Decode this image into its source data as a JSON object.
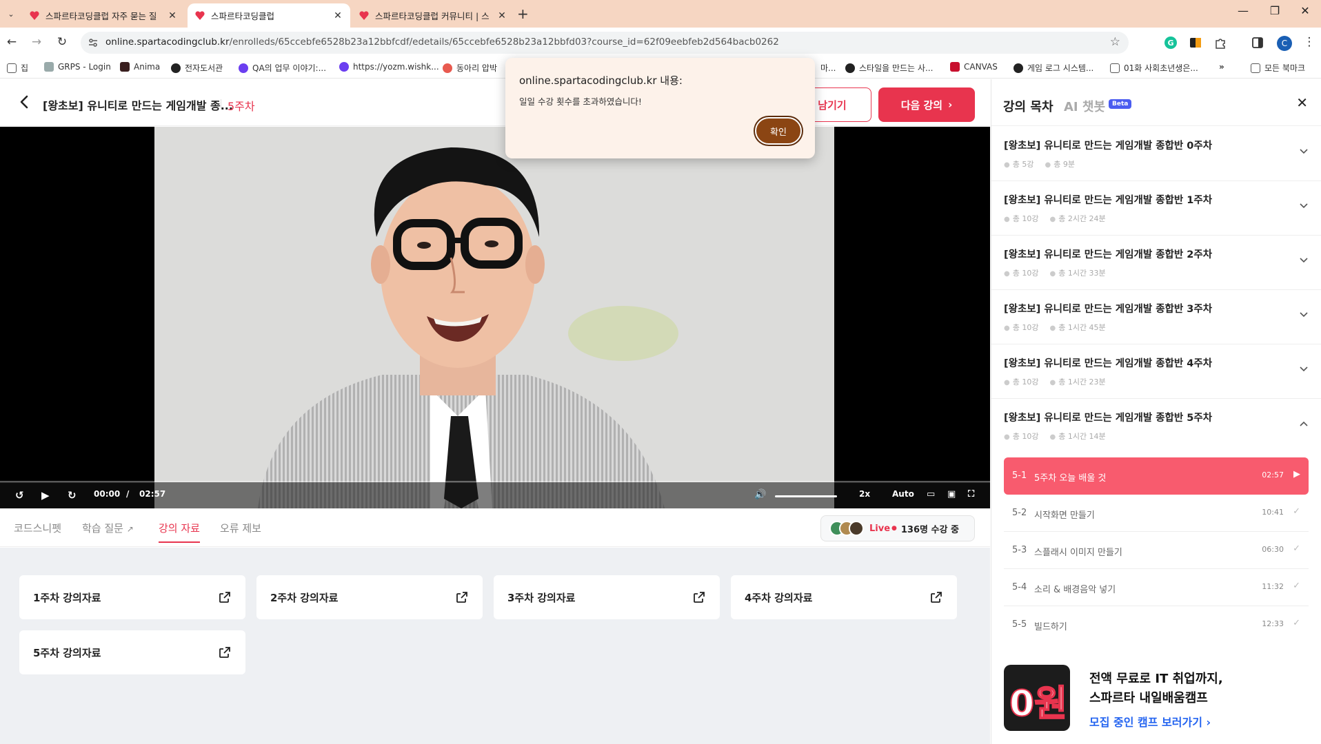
{
  "browser": {
    "tabs": [
      {
        "title": "스파르타코딩클럽 자주 묻는 질"
      },
      {
        "title": "스파르타코딩클럽"
      },
      {
        "title": "스파르타코딩클럽 커뮤니티 | 스"
      }
    ],
    "url_host": "online.spartacodingclub.kr",
    "url_path": "/enrolleds/65ccebfe6528b23a12bbfcdf/edetails/65ccebfe6528b23a12bbfd03?course_id=62f09eebfeb2d564bacb0262",
    "profile_initial": "C",
    "bookmarks": [
      "집",
      "GRPS - Login",
      "Anima",
      "전자도서관",
      "QA의 업무 이야기:...",
      "https://yozm.wishk...",
      "동아리 압박",
      "마...",
      "스타일을 만드는 사...",
      "CANVAS",
      "게임 로그 시스템...",
      "01화 사회초년생은...",
      "모든 북마크"
    ]
  },
  "dialog": {
    "title": "online.spartacodingclub.kr 내용:",
    "message": "일일 수강 횟수를 초과하였습니다!",
    "ok_label": "확인"
  },
  "header": {
    "course_title": "[왕초보] 유니티로 만드는 게임개발 종...",
    "week": "5주차",
    "review_button": "리뷰 남기기",
    "review_button_visible": "남기기",
    "next_button": "다음 강의"
  },
  "player": {
    "current_time": "00:00",
    "divider": "/",
    "duration": "02:57",
    "speed": "2x",
    "quality": "Auto",
    "progress": 0
  },
  "subtabs": {
    "items": [
      {
        "label": "코드스니펫"
      },
      {
        "label": "학습 질문"
      },
      {
        "label": "강의 자료"
      },
      {
        "label": "오류 제보"
      }
    ],
    "live_label": "Live",
    "live_count": "136명 수강 중"
  },
  "materials": [
    {
      "label": "1주차 강의자료"
    },
    {
      "label": "2주차 강의자료"
    },
    {
      "label": "3주차 강의자료"
    },
    {
      "label": "4주차 강의자료"
    },
    {
      "label": "5주차 강의자료"
    }
  ],
  "sidebar": {
    "tab_toc": "강의 목차",
    "tab_ai": "AI 챗봇",
    "beta": "Beta",
    "weeks": [
      {
        "title": "[왕초보] 유니티로 만드는 게임개발 종합반 0주차",
        "count": "총 5강",
        "time": "총 9분"
      },
      {
        "title": "[왕초보] 유니티로 만드는 게임개발 종합반 1주차",
        "count": "총 10강",
        "time": "총 2시간 24분"
      },
      {
        "title": "[왕초보] 유니티로 만드는 게임개발 종합반 2주차",
        "count": "총 10강",
        "time": "총 1시간 33분"
      },
      {
        "title": "[왕초보] 유니티로 만드는 게임개발 종합반 3주차",
        "count": "총 10강",
        "time": "총 1시간 45분"
      },
      {
        "title": "[왕초보] 유니티로 만드는 게임개발 종합반 4주차",
        "count": "총 10강",
        "time": "총 1시간 23분"
      },
      {
        "title": "[왕초보] 유니티로 만드는 게임개발 종합반 5주차",
        "count": "총 10강",
        "time": "총 1시간 14분"
      }
    ],
    "lessons": [
      {
        "no": "5-1",
        "name": "5주차 오늘 배울 것",
        "time": "02:57",
        "status": "▶"
      },
      {
        "no": "5-2",
        "name": "시작화면 만들기",
        "time": "10:41",
        "status": "✓"
      },
      {
        "no": "5-3",
        "name": "스플래시 이미지 만들기",
        "time": "06:30",
        "status": "✓"
      },
      {
        "no": "5-4",
        "name": "소리 & 배경음악 넣기",
        "time": "11:32",
        "status": "✓"
      },
      {
        "no": "5-5",
        "name": "빌드하기",
        "time": "12:33",
        "status": "✓"
      }
    ],
    "promo": {
      "logo_text": "0원",
      "line1": "전액 무료로 IT 취업까지,",
      "line2": "스파르타 내일배움캠프",
      "link": "모집 중인 캠프 보러가기"
    }
  },
  "colors": {
    "brand": "#e8344e",
    "active_lesson": "#f85b6e",
    "tabbar": "#f6d6c2",
    "dialog_ok": "#8b4513"
  }
}
